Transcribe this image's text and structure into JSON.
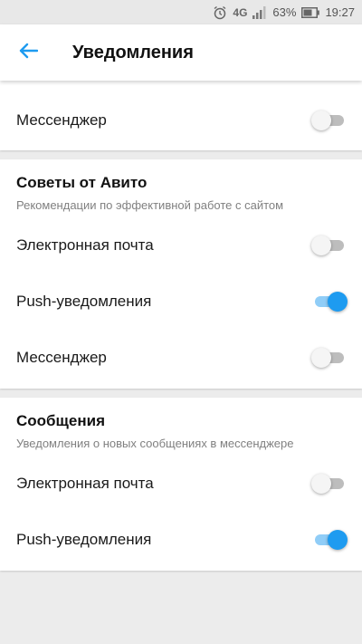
{
  "status_bar": {
    "network": "4G",
    "battery": "63%",
    "time": "19:27"
  },
  "header": {
    "title": "Уведомления",
    "back_icon": "arrow-left-icon",
    "accent_color": "#1e9bf0"
  },
  "sections": [
    {
      "items": [
        {
          "label": "Мессенджер",
          "enabled": false
        }
      ]
    },
    {
      "title": "Советы от Авито",
      "description": "Рекомендации по эффективной работе с сайтом",
      "items": [
        {
          "label": "Электронная почта",
          "enabled": false
        },
        {
          "label": "Push-уведомления",
          "enabled": true
        },
        {
          "label": "Мессенджер",
          "enabled": false
        }
      ]
    },
    {
      "title": "Сообщения",
      "description": "Уведомления о новых сообщениях в мессенджере",
      "items": [
        {
          "label": "Электронная почта",
          "enabled": false
        },
        {
          "label": "Push-уведомления",
          "enabled": true
        }
      ]
    }
  ]
}
